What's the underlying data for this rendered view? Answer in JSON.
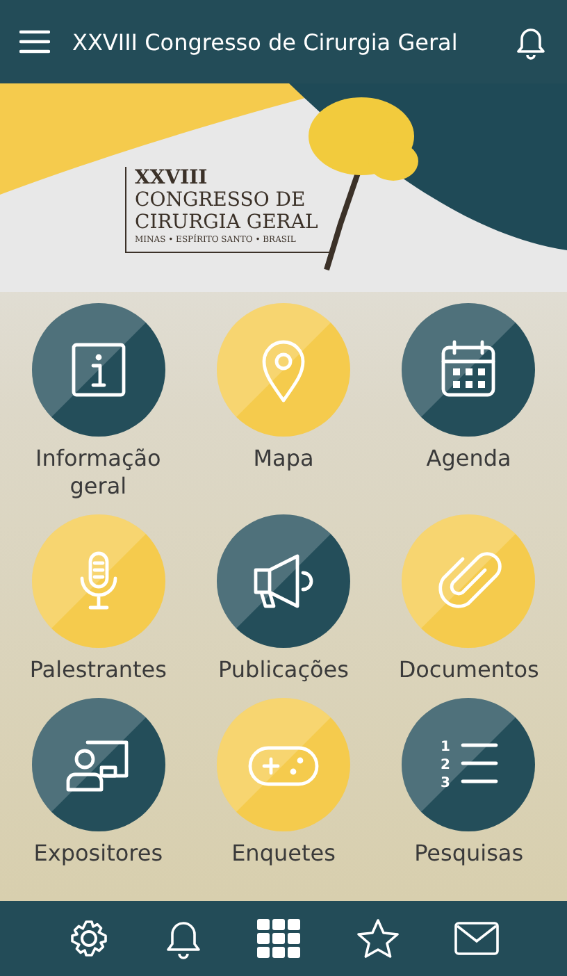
{
  "header": {
    "title": "XXVIII Congresso de Cirurgia Geral"
  },
  "banner": {
    "edition": "XXVIII",
    "line_1": "CONGRESSO DE",
    "line_2": "CIRURGIA GERAL",
    "subtitle": "MINAS • ESPÍRITO SANTO • BRASIL"
  },
  "tiles": [
    {
      "label": "Informação geral",
      "color": "#244e5a"
    },
    {
      "label": "Mapa",
      "color": "#f5cb4d"
    },
    {
      "label": "Agenda",
      "color": "#244e5a"
    },
    {
      "label": "Palestrantes",
      "color": "#f5cb4d"
    },
    {
      "label": "Publicações",
      "color": "#244e5a"
    },
    {
      "label": "Documentos",
      "color": "#f5cb4d"
    },
    {
      "label": "Expositores",
      "color": "#244e5a"
    },
    {
      "label": "Enquetes",
      "color": "#f5cb4d"
    },
    {
      "label": "Pesquisas",
      "color": "#244e5a"
    }
  ],
  "list_icon_numbers": [
    "1",
    "2",
    "3"
  ]
}
